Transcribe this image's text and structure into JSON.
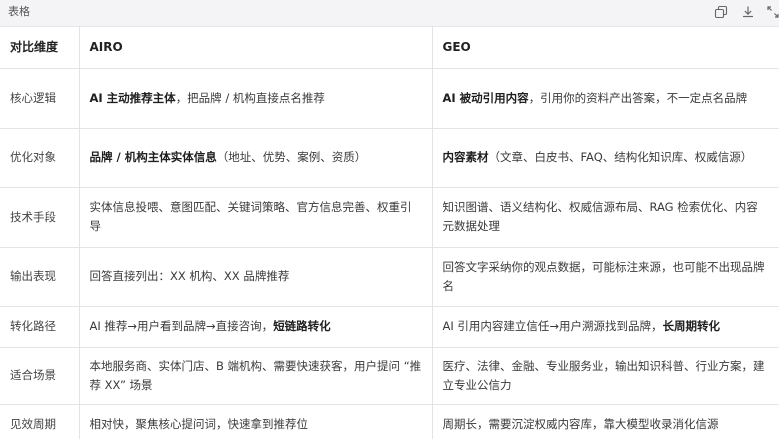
{
  "toolbar": {
    "title": "表格",
    "icons": [
      "copy-icon",
      "download-icon",
      "expand-icon"
    ]
  },
  "table": {
    "headers": [
      "对比维度",
      "AIRO",
      "GEO"
    ],
    "rows": [
      {
        "dimension": "核心逻辑",
        "airo": {
          "bold": "AI 主动推荐主体",
          "rest": "，把品牌 / 机构直接点名推荐"
        },
        "geo": {
          "bold": "AI 被动引用内容",
          "rest": "，引用你的资料产出答案，不一定点名品牌"
        }
      },
      {
        "dimension": "优化对象",
        "airo": {
          "bold": "品牌 / 机构主体实体信息",
          "rest": "（地址、优势、案例、资质）"
        },
        "geo": {
          "bold": "内容素材",
          "rest": "（文章、白皮书、FAQ、结构化知识库、权威信源）"
        }
      },
      {
        "dimension": "技术手段",
        "airo": {
          "bold": "",
          "rest": "实体信息投喂、意图匹配、关键词策略、官方信息完善、权重引导"
        },
        "geo": {
          "bold": "",
          "rest": "知识图谱、语义结构化、权威信源布局、RAG 检索优化、内容元数据处理"
        }
      },
      {
        "dimension": "输出表现",
        "airo": {
          "bold": "",
          "rest": "回答直接列出：XX 机构、XX 品牌推荐"
        },
        "geo": {
          "bold": "",
          "rest": "回答文字采纳你的观点数据，可能标注来源，也可能不出现品牌名"
        }
      },
      {
        "dimension": "转化路径",
        "airo": {
          "pre": "AI 推荐→用户看到品牌→直接咨询，",
          "bold": "短链路转化"
        },
        "geo": {
          "pre": "AI 引用内容建立信任→用户溯源找到品牌，",
          "bold": "长周期转化"
        }
      },
      {
        "dimension": "适合场景",
        "airo": {
          "bold": "",
          "rest": "本地服务商、实体门店、B 端机构、需要快速获客，用户提问 “推荐 XX” 场景"
        },
        "geo": {
          "bold": "",
          "rest": "医疗、法律、金融、专业服务业，输出知识科普、行业方案，建立专业公信力"
        }
      },
      {
        "dimension": "见效周期",
        "airo": {
          "bold": "",
          "rest": "相对快，聚焦核心提问词，快速拿到推荐位"
        },
        "geo": {
          "bold": "",
          "rest": "周期长，需要沉淀权威内容库，靠大模型收录消化信源"
        }
      }
    ]
  }
}
